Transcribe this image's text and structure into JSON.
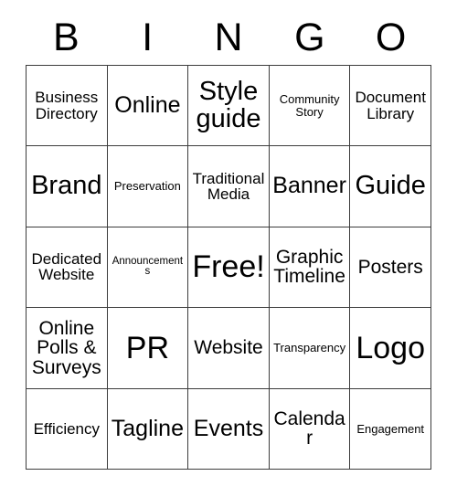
{
  "card": {
    "title_letters": [
      "B",
      "I",
      "N",
      "G",
      "O"
    ],
    "columns": 5,
    "rows": 5,
    "free_space_label": "Free!",
    "colors": {
      "background": "#ffffff",
      "grid_line": "#3c3c3c",
      "text": "#000000"
    },
    "cells": [
      [
        {
          "label": "Business Directory",
          "size": "sm"
        },
        {
          "label": "Online",
          "size": "lg"
        },
        {
          "label": "Style guide",
          "size": "xl"
        },
        {
          "label": "Community Story",
          "size": "xs"
        },
        {
          "label": "Document Library",
          "size": "sm"
        }
      ],
      [
        {
          "label": "Brand",
          "size": "xl"
        },
        {
          "label": "Preservation",
          "size": "xs"
        },
        {
          "label": "Traditional Media",
          "size": "sm"
        },
        {
          "label": "Banner",
          "size": "lg"
        },
        {
          "label": "Guide",
          "size": "xl"
        }
      ],
      [
        {
          "label": "Dedicated Website",
          "size": "sm"
        },
        {
          "label": "Announcements",
          "size": "xxs"
        },
        {
          "label": "Free!",
          "size": "xxl"
        },
        {
          "label": "Graphic Timeline",
          "size": "md"
        },
        {
          "label": "Posters",
          "size": "md"
        }
      ],
      [
        {
          "label": "Online Polls & Surveys",
          "size": "md"
        },
        {
          "label": "PR",
          "size": "xxl"
        },
        {
          "label": "Website",
          "size": "md"
        },
        {
          "label": "Transparency",
          "size": "xs"
        },
        {
          "label": "Logo",
          "size": "xxl"
        }
      ],
      [
        {
          "label": "Efficiency",
          "size": "sm"
        },
        {
          "label": "Tagline",
          "size": "lg"
        },
        {
          "label": "Events",
          "size": "lg"
        },
        {
          "label": "Calendar",
          "size": "md"
        },
        {
          "label": "Engagement",
          "size": "xs"
        }
      ]
    ]
  }
}
